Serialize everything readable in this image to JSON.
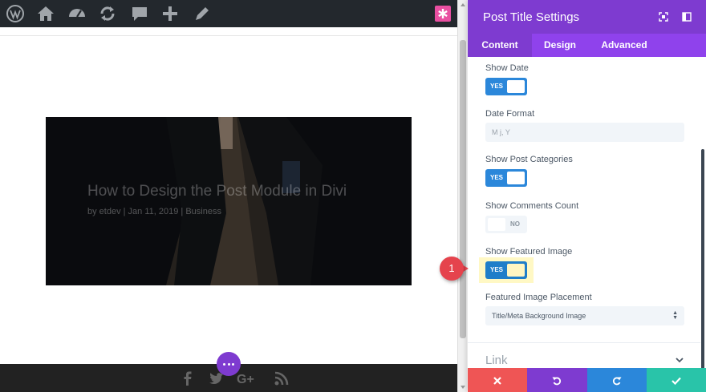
{
  "adminbar": {
    "icons": [
      "wordpress-icon",
      "dashboard-home-icon",
      "gauge-icon",
      "refresh-icon",
      "comment-icon",
      "plus-icon",
      "pencil-icon"
    ],
    "divi_icon": "asterisk-icon"
  },
  "hero": {
    "title": "How to Design the Post Module in Divi",
    "meta": "by etdev | Jan 11, 2019 | Business"
  },
  "footer": {
    "social_icons": [
      "facebook-icon",
      "twitter-icon",
      "google-plus-icon",
      "rss-icon"
    ],
    "dots_icon": "more-dots-icon"
  },
  "callout": {
    "number": "1"
  },
  "panel": {
    "title": "Post Title Settings",
    "header_icons": [
      "expand-icon",
      "split-view-icon"
    ],
    "tabs": [
      {
        "label": "Content",
        "active": true
      },
      {
        "label": "Design",
        "active": false
      },
      {
        "label": "Advanced",
        "active": false
      }
    ],
    "fields": {
      "show_date": {
        "label": "Show Date",
        "value": "YES"
      },
      "date_format": {
        "label": "Date Format",
        "placeholder": "M j, Y"
      },
      "show_post_categories": {
        "label": "Show Post Categories",
        "value": "YES"
      },
      "show_comments_count": {
        "label": "Show Comments Count",
        "value": "NO"
      },
      "show_featured_image": {
        "label": "Show Featured Image",
        "value": "YES"
      },
      "featured_image_placement": {
        "label": "Featured Image Placement",
        "value": "Title/Meta Background Image"
      }
    },
    "section": {
      "label": "Link"
    },
    "footer_buttons": [
      {
        "name": "cancel",
        "icon": "close-icon",
        "color": "#ef5555"
      },
      {
        "name": "undo",
        "icon": "undo-icon",
        "color": "#7e3bd0"
      },
      {
        "name": "redo",
        "icon": "redo-icon",
        "color": "#2b87da"
      },
      {
        "name": "save",
        "icon": "check-icon",
        "color": "#29c4a9"
      }
    ]
  },
  "colors": {
    "accent_purple": "#7e3bd0",
    "toggle_on": "#2b87da",
    "highlight": "#fff8c4",
    "callout_red": "#e5434d"
  }
}
